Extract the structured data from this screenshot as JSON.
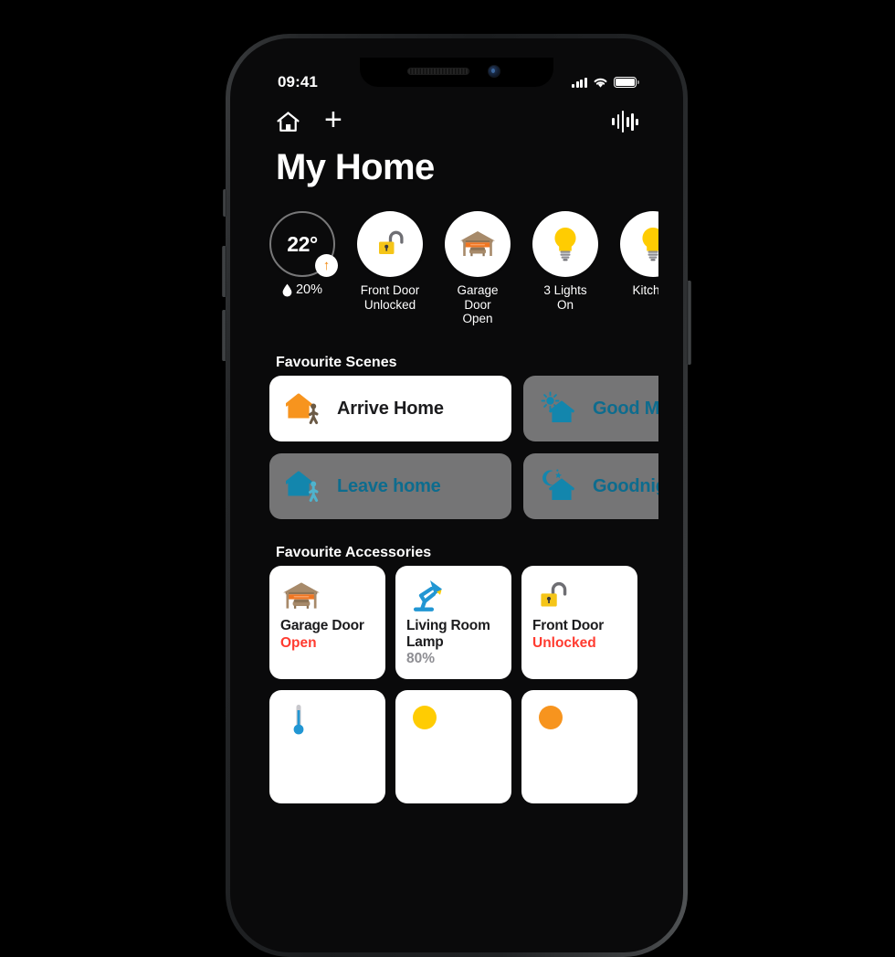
{
  "device": {
    "name": "smartphone-mockup",
    "frame_color": "#242628",
    "screen_bg_top": "#10b0c4",
    "screen_bg_bottom": "#0c5f74"
  },
  "status_bar": {
    "time": "09:41",
    "cellular_icon": "signal-bars-icon",
    "wifi_icon": "wifi-icon",
    "battery_icon": "battery-full-icon"
  },
  "nav": {
    "home_icon": "home-icon",
    "add_icon": "plus-icon",
    "intercom_icon": "waveform-icon"
  },
  "header": {
    "title": "My Home"
  },
  "status_strip": {
    "climate": {
      "temperature": "22°",
      "rising_icon": "arrow-up-icon",
      "humidity_icon": "water-drop-icon",
      "humidity": "20%"
    },
    "items": [
      {
        "icon": "unlocked-padlock-icon",
        "label": "Front Door\nUnlocked"
      },
      {
        "icon": "garage-door-open-icon",
        "label": "Garage Door\nOpen"
      },
      {
        "icon": "lightbulb-on-icon",
        "label": "3 Lights\nOn"
      },
      {
        "icon": "lightbulb-on-icon",
        "label": "Kitchen"
      }
    ]
  },
  "scenes": {
    "title": "Favourite Scenes",
    "items": [
      {
        "label": "Arrive Home",
        "icon": "house-arrive-icon",
        "active": true
      },
      {
        "label": "Good Morning",
        "icon": "house-sun-icon",
        "active": false
      },
      {
        "label": "Leave home",
        "icon": "house-leave-icon",
        "active": false
      },
      {
        "label": "Goodnight",
        "icon": "house-moon-icon",
        "active": false
      }
    ]
  },
  "accessories": {
    "title": "Favourite Accessories",
    "items": [
      {
        "icon": "garage-door-open-icon",
        "name": "Garage\nDoor",
        "state": "Open",
        "state_style": "alert"
      },
      {
        "icon": "desk-lamp-icon",
        "name": "Living Room\nLamp",
        "state": "80%",
        "state_style": "muted"
      },
      {
        "icon": "unlocked-padlock-icon",
        "name": "Front\nDoor",
        "state": "Unlocked",
        "state_style": "alert"
      }
    ],
    "partial_row_icons": [
      "thermometer-icon",
      "lightbulb-yellow-icon",
      "lightbulb-orange-icon"
    ]
  },
  "colors": {
    "accent_teal": "#0fb2c6",
    "scene_text": "#0d6c8e",
    "alert_red": "#ff3b30",
    "muted_gray": "#8e8e93",
    "lock_yellow": "#f5c518",
    "garage_orange": "#ef7622"
  }
}
